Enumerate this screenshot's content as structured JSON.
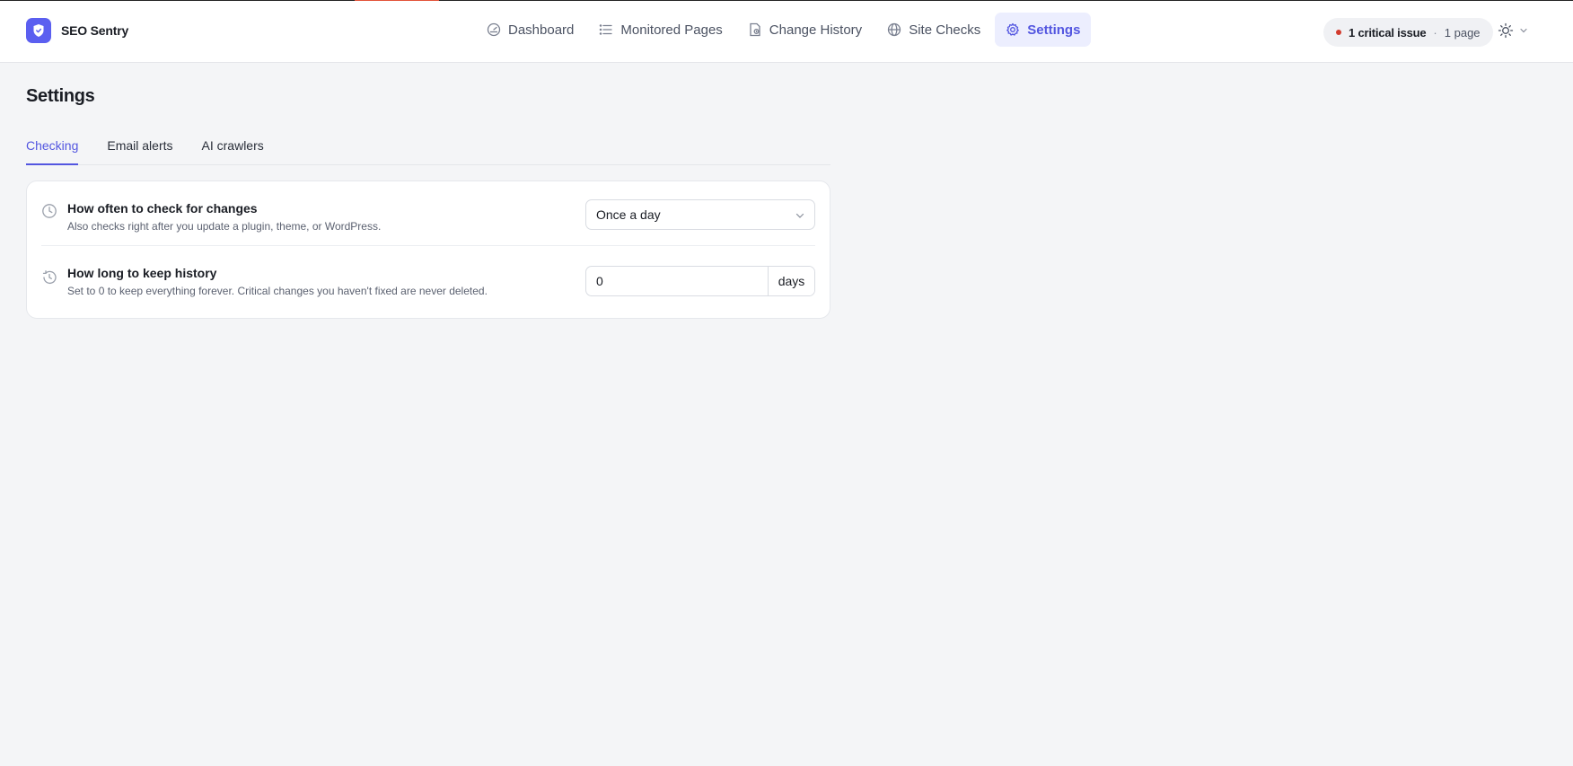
{
  "app": {
    "name": "SEO Sentry",
    "accent": "#5b5ff0"
  },
  "nav": {
    "items": [
      {
        "label": "Dashboard",
        "icon": "gauge-icon"
      },
      {
        "label": "Monitored Pages",
        "icon": "list-icon"
      },
      {
        "label": "Change History",
        "icon": "history-doc-icon"
      },
      {
        "label": "Site Checks",
        "icon": "globe-icon"
      },
      {
        "label": "Settings",
        "icon": "gear-icon",
        "active": true
      }
    ]
  },
  "status": {
    "main": "1 critical issue",
    "separator": "·",
    "sub": "1 page",
    "dot_color": "#d23b2e"
  },
  "theme": {
    "icon": "sun-icon"
  },
  "page": {
    "title": "Settings"
  },
  "tabs": [
    {
      "label": "Checking",
      "active": true
    },
    {
      "label": "Email alerts"
    },
    {
      "label": "AI crawlers"
    }
  ],
  "settings": {
    "frequency": {
      "title": "How often to check for changes",
      "description": "Also checks right after you update a plugin, theme, or WordPress.",
      "value": "Once a day",
      "icon": "clock-icon"
    },
    "retention": {
      "title": "How long to keep history",
      "description": "Set to 0 to keep everything forever. Critical changes you haven't fixed are never deleted.",
      "value": "0",
      "suffix": "days",
      "icon": "history-icon"
    }
  }
}
